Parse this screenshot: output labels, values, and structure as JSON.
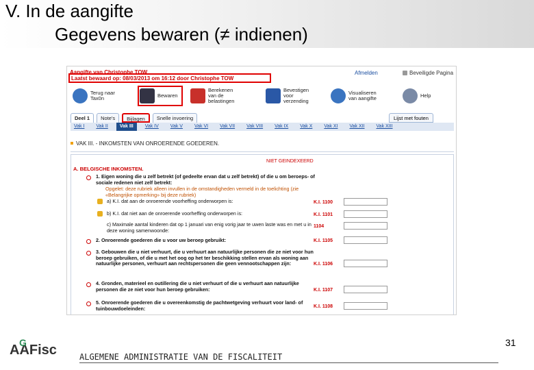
{
  "slide": {
    "title_line1": "V. In de aangifte",
    "title_line2": "Gegevens bewaren (≠ indienen)",
    "footer_logo": "AAFisc",
    "footer_logo_mark": "G",
    "footer_org": "ALGEMENE ADMINISTRATIE VAN DE FISCALITEIT",
    "page_number": "31"
  },
  "screenshot": {
    "decl_title": "Aangifte van Christophe TOW",
    "decl_saved": "Laatst bewaard op: 08/03/2013 om 16:12 door Christophe TOW",
    "logout": "Afmelden",
    "secure_page": "Beveiligde Pagina",
    "toolbar": [
      {
        "label": "Terug naar\nTax0n",
        "icon": "back-icon",
        "color": "#3a74c0"
      },
      {
        "label": "Bewaren",
        "icon": "save-icon",
        "color": "#334"
      },
      {
        "label": "Berekenen\nvan de\nbelastingen",
        "icon": "calculator-icon",
        "color": "#c8302a"
      },
      {
        "label": "Bevestigen\nvoor\nverzending",
        "icon": "send-icon",
        "color": "#2a58a6"
      },
      {
        "label": "Visualiseren\nvan aangifte",
        "icon": "view-icon",
        "color": "#3a74c0"
      },
      {
        "label": "Help",
        "icon": "help-icon",
        "color": "#7a8aa6"
      }
    ],
    "tabs": [
      "Deel 1",
      "Note's",
      "Bijlagen",
      "Snelle invoering"
    ],
    "tab_right": "Lijst met fouten",
    "subtabs": [
      "Vak I",
      "Vak II",
      "Vak III",
      "Vak IV",
      "Vak V",
      "Vak VI",
      "Vak VII",
      "Vak VIII",
      "Vak IX",
      "Vak X",
      "Vak XI",
      "Vak XII",
      "Vak XIII"
    ],
    "active_subtab": "Vak III",
    "section_heading": "VAK III. - INKOMSTEN VAN ONROERENDE GOEDEREN.",
    "subsection": "A. BELGISCHE INKOMSTEN.",
    "not_indexed": "NIET GEINDEXEERD",
    "questions": [
      {
        "text": "1. Eigen woning die u zelf betrekt (of gedeelte ervan dat u zelf betrekt) of die u om beroeps- of sociale redenen niet zelf betrekt:",
        "style": "bold",
        "code": ""
      },
      {
        "text": "Opgelet: deze rubriek alleen invullen in de omstandigheden vermeld in de toelichting (zie «Belangrijke opmerking» bij deze rubriek)",
        "style": "orange",
        "code": ""
      },
      {
        "text": "a) K.I. dat aan de onroerende voorheffing onderworpen is:",
        "style": "",
        "code": "K.I. 1100"
      },
      {
        "text": "b) K.I. dat niet aan de onroerende voorheffing onderworpen is:",
        "style": "",
        "code": "K.I. 1101"
      },
      {
        "text": "c) Maximale aantal kinderen dat op 1 januari van enig vorig jaar te uwen laste was en met u in deze woning samenwoonde:",
        "style": "",
        "code": "1104"
      },
      {
        "text": "2. Onroerende goederen die u voor uw beroep gebruikt:",
        "style": "bold",
        "code": "K.I. 1105"
      },
      {
        "text": "3. Gebouwen die u niet verhuurt, die u verhuurt aan natuurlijke personen die ze niet voor hun beroep gebruiken, of die u met het oog op het ter beschikking stellen ervan als woning aan natuurlijke personen, verhuurt aan rechtspersonen die geen vennootschappen zijn:",
        "style": "bold",
        "code": "K.I. 1106"
      },
      {
        "text": "4. Gronden, materieel en outillering die u niet verhuurt of die u verhuurt aan natuurlijke personen die ze niet voor hun beroep gebruiken:",
        "style": "bold",
        "code": "K.I. 1107"
      },
      {
        "text": "5. Onroerende goederen die u overeenkomstig de pachtwetgeving verhuurt voor land- of tuinbouwdoeleinden:",
        "style": "bold",
        "code": "K.I. 1108"
      }
    ]
  }
}
